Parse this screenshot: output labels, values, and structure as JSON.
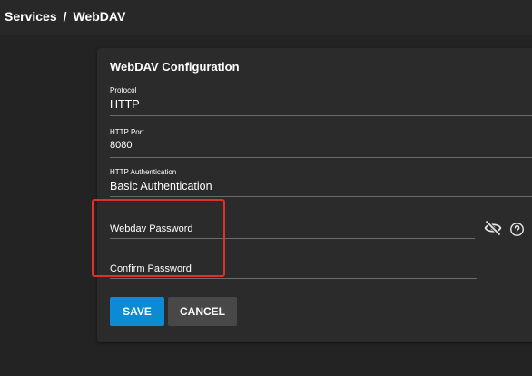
{
  "breadcrumb": {
    "items": [
      "Services",
      "WebDAV"
    ],
    "separator": "/"
  },
  "card": {
    "title": "WebDAV Configuration"
  },
  "fields": {
    "protocol": {
      "label": "Protocol",
      "value": "HTTP"
    },
    "http_port": {
      "label": "HTTP Port",
      "value": "8080"
    },
    "http_auth": {
      "label": "HTTP Authentication",
      "value": "Basic Authentication"
    }
  },
  "password": {
    "webdav_placeholder": "Webdav Password",
    "confirm_placeholder": "Confirm Password",
    "visibility_icon": "eye-off-icon",
    "help_icon": "help-circle-icon"
  },
  "actions": {
    "save_label": "SAVE",
    "cancel_label": "CANCEL"
  },
  "colors": {
    "primary": "#0b8bd4",
    "secondary_button": "#484848",
    "highlight": "#e0302c",
    "background": "#232323",
    "card": "#2b2b2b"
  }
}
